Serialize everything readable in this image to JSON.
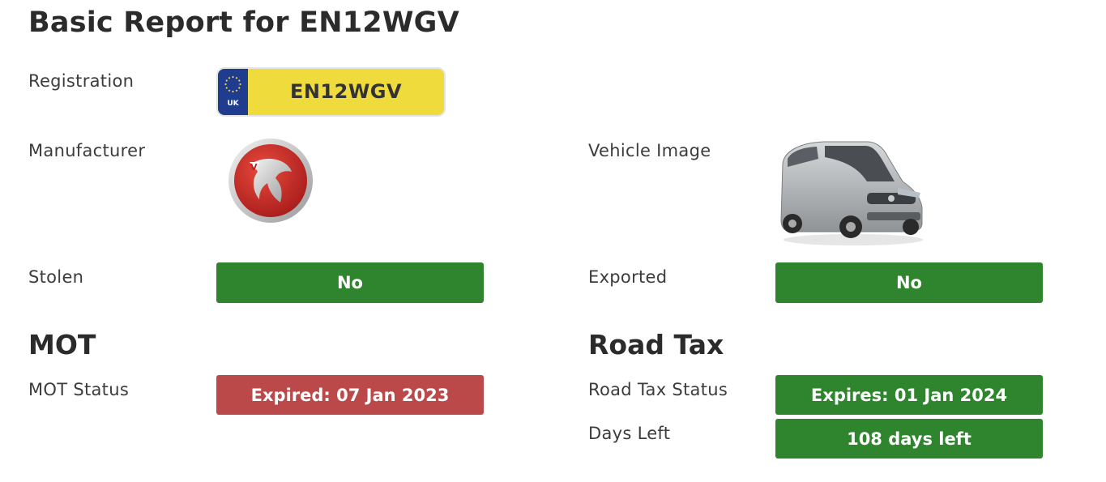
{
  "report": {
    "title": "Basic Report for EN12WGV"
  },
  "labels": {
    "registration": "Registration",
    "manufacturer": "Manufacturer",
    "vehicle_image": "Vehicle Image",
    "stolen": "Stolen",
    "exported": "Exported",
    "mot_status": "MOT Status",
    "road_tax_status": "Road Tax Status",
    "days_left": "Days Left"
  },
  "plate": {
    "region": "UK",
    "registration": "EN12WGV"
  },
  "manufacturer": {
    "logo_icon": "vauxhall-griffin-logo-icon"
  },
  "vehicle": {
    "image_icon": "silver-van-image"
  },
  "values": {
    "stolen": "No",
    "exported": "No",
    "mot_status": "Expired: 07 Jan 2023",
    "road_tax_status": "Expires: 01 Jan 2024",
    "days_left": "108 days left"
  },
  "sections": {
    "mot": "MOT",
    "road_tax": "Road Tax"
  },
  "colors": {
    "ok": "#2e852e",
    "bad": "#bb4949",
    "plate_yellow": "#f0db3d",
    "plate_blue": "#1f3c8f"
  }
}
